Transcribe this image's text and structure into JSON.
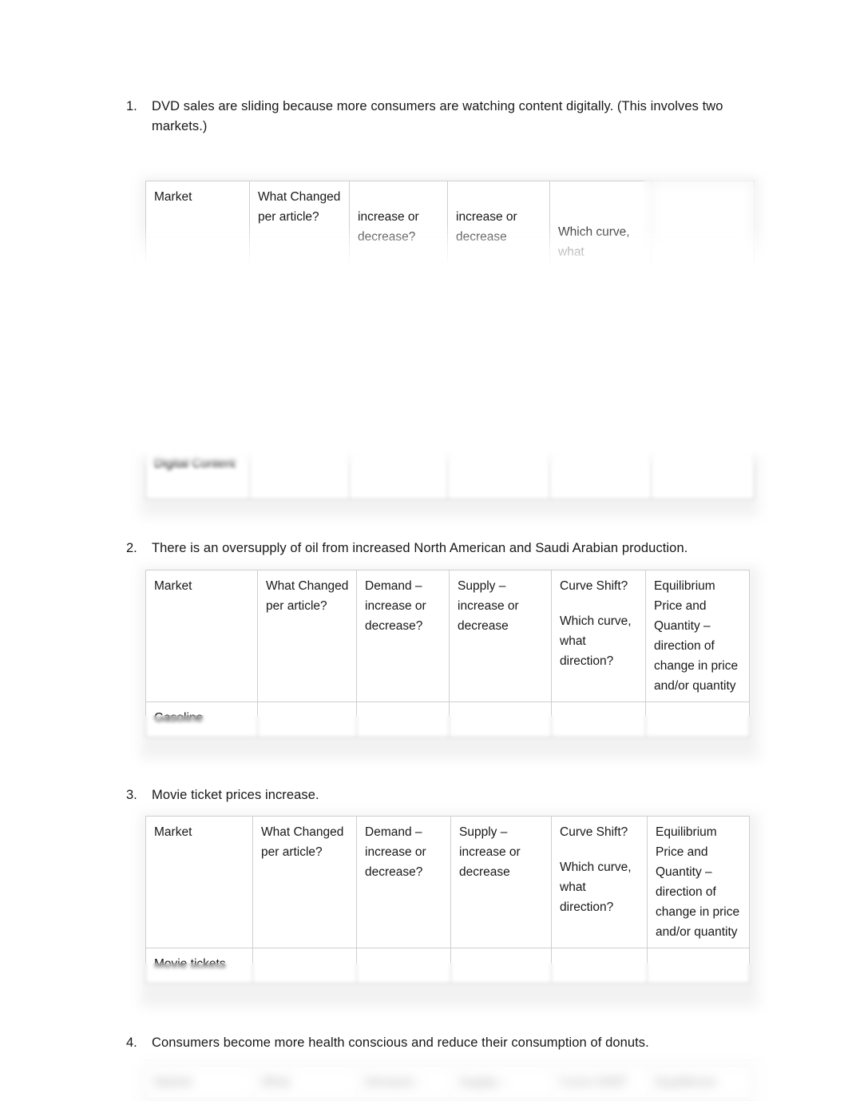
{
  "document": {
    "type": "worksheet",
    "page_background": "#ffffff",
    "text_color": "#181818",
    "table_border_color": "#cfcfcf"
  },
  "questions": [
    {
      "number": "1.",
      "text": "DVD sales are sliding because more consumers are watching content digitally. (This involves two markets.)"
    },
    {
      "number": "2.",
      "text": "There is an oversupply of oil from increased North American and Saudi Arabian production."
    },
    {
      "number": "3.",
      "text": "Movie ticket prices increase."
    },
    {
      "number": "4.",
      "text": "Consumers become more health conscious and reduce their consumption of donuts."
    }
  ],
  "tables": {
    "table1": {
      "headers": {
        "market": "Market",
        "what_changed": "What Changed per article?",
        "demand": "increase or decrease?",
        "supply": "increase or decrease",
        "curve_shift_a": "Which curve,",
        "curve_shift_b": "what",
        "equilibrium": ""
      },
      "rows": [
        {
          "market": "Digital Content",
          "what_changed": "",
          "demand": "",
          "supply": "",
          "curve_shift": "",
          "equilibrium": ""
        }
      ]
    },
    "table2": {
      "headers": {
        "market": "Market",
        "what_changed": "What Changed per article?",
        "demand": "Demand – increase or decrease?",
        "supply": "Supply – increase or decrease",
        "curve_shift_title": "Curve Shift?",
        "curve_shift_body": "Which curve, what direction?",
        "equilibrium": "Equilibrium Price and Quantity – direction of change in price and/or quantity"
      },
      "rows": [
        {
          "market": "Gasoline",
          "what_changed": "",
          "demand": "",
          "supply": "",
          "curve_shift": "",
          "equilibrium": ""
        }
      ]
    },
    "table3": {
      "headers": {
        "market": "Market",
        "what_changed": "What Changed per article?",
        "demand": "Demand – increase or decrease?",
        "supply": "Supply – increase or decrease",
        "curve_shift_title": "Curve Shift?",
        "curve_shift_body": "Which curve, what direction?",
        "equilibrium": "Equilibrium Price and Quantity – direction of change in price and/or quantity"
      },
      "rows": [
        {
          "market": "Movie tickets",
          "what_changed": "",
          "demand": "",
          "supply": "",
          "curve_shift": "",
          "equilibrium": ""
        }
      ]
    },
    "table4": {
      "headers": {
        "market": "Market",
        "what_changed": "What",
        "demand": "Demand –",
        "supply": "Supply –",
        "curve_shift_title": "Curve Shift?",
        "curve_shift_body": "",
        "equilibrium": "Equilibrium"
      },
      "rows": []
    }
  }
}
